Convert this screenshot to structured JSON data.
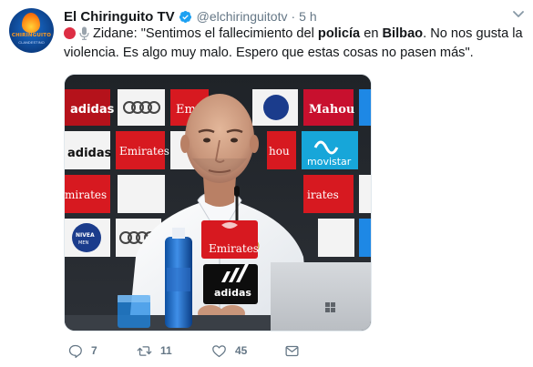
{
  "tweet": {
    "author": {
      "display_name": "El Chiringuito TV",
      "handle": "@elchiringuitotv",
      "verified": true,
      "avatar_logo": "CHIRINGUITO",
      "avatar_sub": "CLANDESTINO"
    },
    "separator": "·",
    "time": "5 h",
    "text": {
      "part1": "Zidane: \"Sentimos el fallecimiento del ",
      "bold1": "policía",
      "part2": " en ",
      "bold2": "Bilbao",
      "part3": ". No nos gusta la violencia. Es algo muy malo. Espero que estas cosas no pasen más\"."
    },
    "icons": {
      "rec": "red-circle-icon",
      "mic": "microphone-icon",
      "more": "chevron-down-icon"
    },
    "media": {
      "sponsor_boards": [
        "adidas",
        "Emirates",
        "Mahou",
        "movistar",
        "NIVEA MEN",
        "AUDI"
      ],
      "mic_board": "Emirates",
      "podium_logo": "adidas"
    },
    "actions": {
      "reply_count": "7",
      "retweet_count": "11",
      "like_count": "45"
    },
    "colors": {
      "accent": "#1da1f2",
      "secondary_text": "#657786",
      "rec": "#dd2e44"
    }
  }
}
